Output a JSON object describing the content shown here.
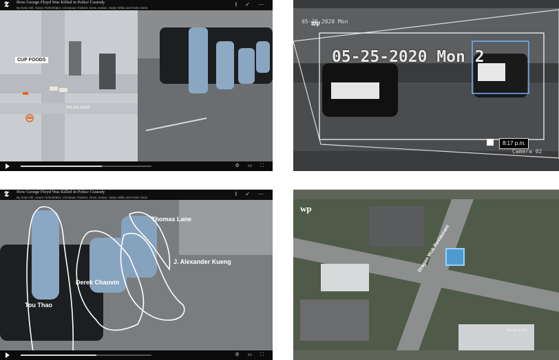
{
  "nyt_video_1": {
    "headline": "How George Floyd Was Killed in Police Custody",
    "subline": "By Evan Hill, Ainara Tiefenthäler, Christiaan Triebert, Drew Jordan, Haley Willis and Robin Stein",
    "labels": {
      "store": "CUP FOODS",
      "cars": "POLICE CARS"
    },
    "progress_fraction": 0.62
  },
  "wp_surveillance": {
    "overlay_timestamp": "05-25-2020 Mon 2",
    "small_timestamp": "05-25-2020 Mon",
    "time_badge": "8:17 p.m.",
    "camera_label": "Camera 02"
  },
  "nyt_video_2": {
    "headline": "How George Floyd Was Killed in Police Custody",
    "subline": "By Evan Hill, Ainara Tiefenthäler, Christiaan Triebert, Drew Jordan, Haley Willis and Robin Stein",
    "officers": [
      {
        "name": "Thomas Lane"
      },
      {
        "name": "J. Alexander Kueng"
      },
      {
        "name": "Derek Chauvin"
      },
      {
        "name": "Tou Thao"
      }
    ],
    "progress_fraction": 0.58
  },
  "wp_map": {
    "logo": "wp",
    "place_label": "Dragon Wok Restaurant",
    "attribution": "Google Earth"
  },
  "colors": {
    "highlight_box": "#6fb3ff",
    "overlay_white": "#ffffff"
  }
}
